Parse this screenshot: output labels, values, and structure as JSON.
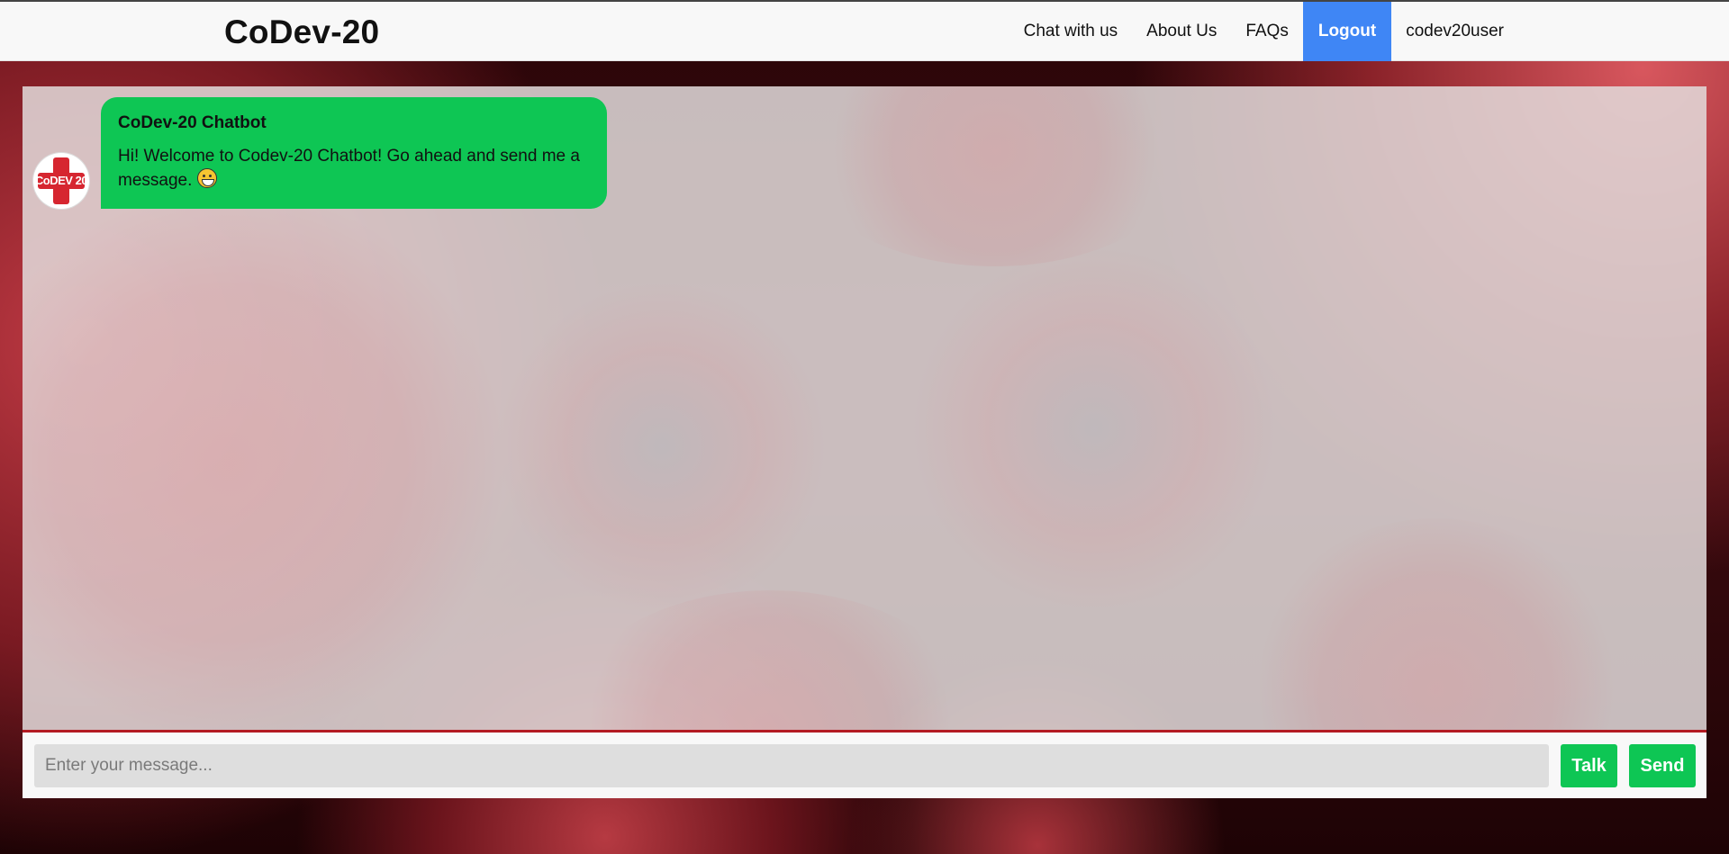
{
  "brand": "CoDev-20",
  "nav": {
    "items": [
      {
        "label": "Chat with us"
      },
      {
        "label": "About Us"
      },
      {
        "label": "FAQs"
      },
      {
        "label": "Logout"
      },
      {
        "label": "codev20user"
      }
    ]
  },
  "chat": {
    "messages": [
      {
        "sender": "CoDev-20 Chatbot",
        "text": "Hi! Welcome to Codev-20 Chatbot! Go ahead and send me a message.",
        "emoji": "grinning-face",
        "avatar_text": "CoDEV 20"
      }
    ]
  },
  "composer": {
    "placeholder": "Enter your message...",
    "talk_label": "Talk",
    "send_label": "Send"
  },
  "colors": {
    "accent_green": "#0ec654",
    "logout_blue": "#3f86f5",
    "divider_red": "#b31a22"
  }
}
